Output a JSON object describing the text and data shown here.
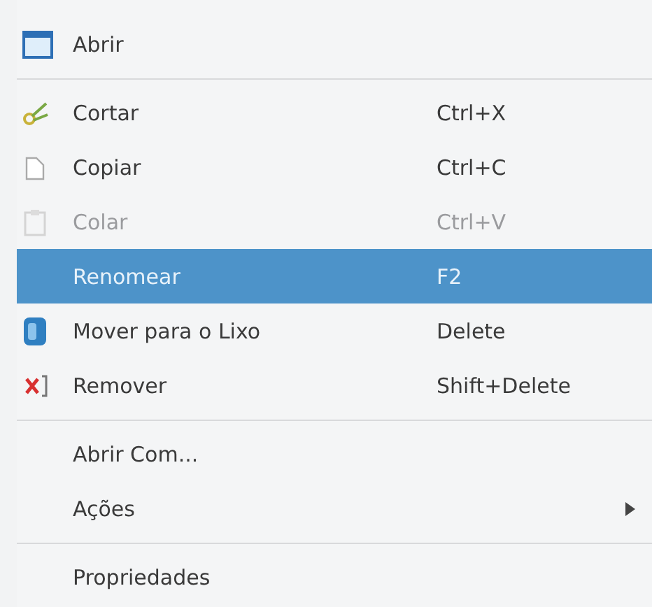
{
  "menu": {
    "items": [
      {
        "kind": "item",
        "label": "Abrir",
        "disabled": false,
        "selected": false,
        "submenu": false
      },
      {
        "kind": "separator"
      },
      {
        "kind": "item",
        "label": "Cortar",
        "shortcut": "Ctrl+X",
        "disabled": false,
        "selected": false,
        "submenu": false
      },
      {
        "kind": "item",
        "label": "Copiar",
        "shortcut": "Ctrl+C",
        "disabled": false,
        "selected": false,
        "submenu": false
      },
      {
        "kind": "item",
        "label": "Colar",
        "shortcut": "Ctrl+V",
        "disabled": true,
        "selected": false,
        "submenu": false
      },
      {
        "kind": "item",
        "label": "Renomear",
        "shortcut": "F2",
        "disabled": false,
        "selected": true,
        "submenu": false
      },
      {
        "kind": "item",
        "label": "Mover para o Lixo",
        "shortcut": "Delete",
        "disabled": false,
        "selected": false,
        "submenu": false
      },
      {
        "kind": "item",
        "label": "Remover",
        "shortcut": "Shift+Delete",
        "disabled": false,
        "selected": false,
        "submenu": false
      },
      {
        "kind": "separator"
      },
      {
        "kind": "item",
        "label": "Abrir Com...",
        "disabled": false,
        "selected": false,
        "submenu": false
      },
      {
        "kind": "item",
        "label": "Ações",
        "disabled": false,
        "selected": false,
        "submenu": true
      },
      {
        "kind": "separator"
      },
      {
        "kind": "item",
        "label": "Propriedades",
        "disabled": false,
        "selected": false,
        "submenu": false
      }
    ]
  }
}
